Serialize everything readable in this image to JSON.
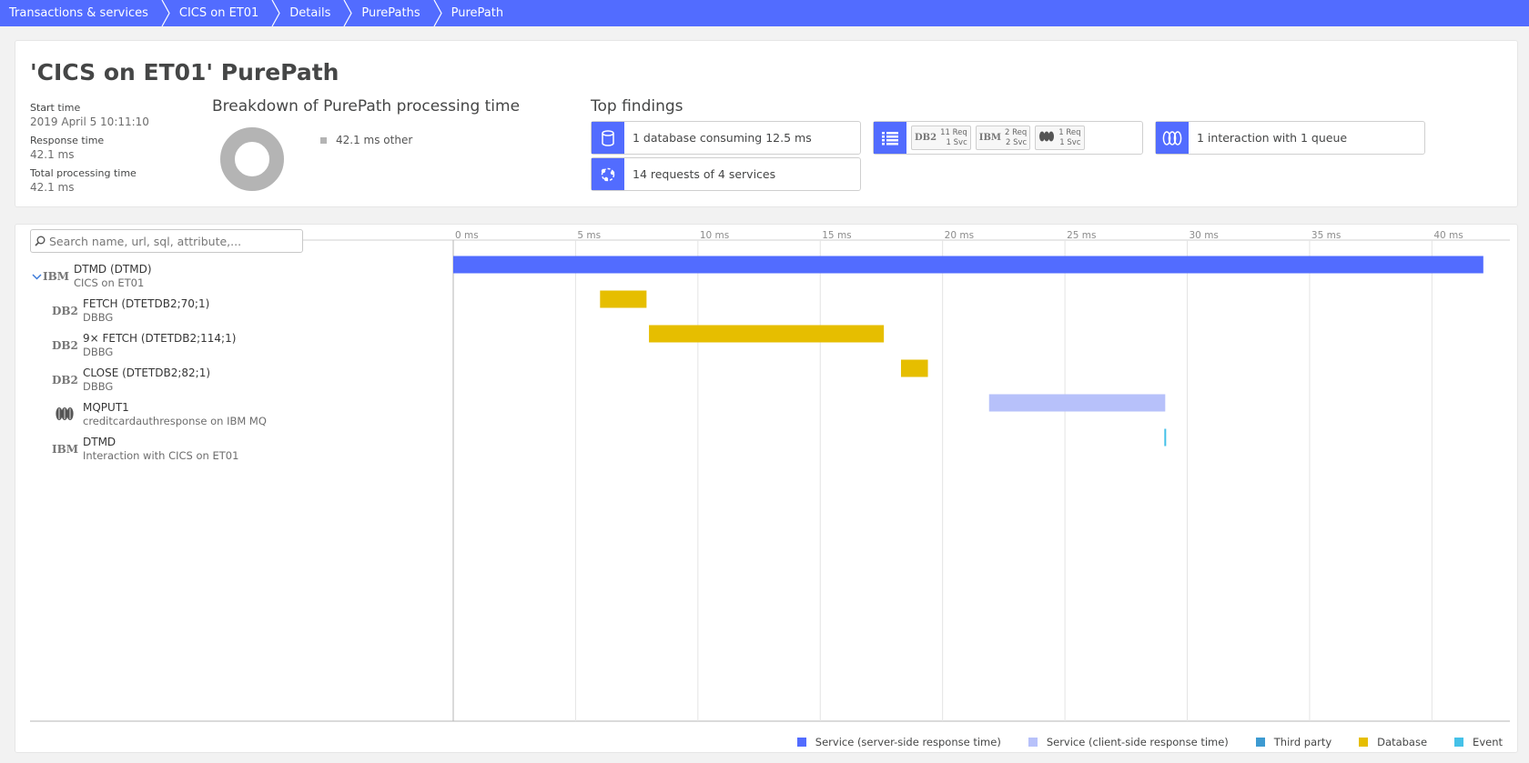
{
  "breadcrumb": [
    {
      "label": "Transactions & services"
    },
    {
      "label": "CICS on ET01"
    },
    {
      "label": "Details"
    },
    {
      "label": "PurePaths"
    },
    {
      "label": "PurePath"
    }
  ],
  "header": {
    "title": "'CICS on ET01' PurePath",
    "start_time_label": "Start time",
    "start_time_value": "2019 April 5 10:11:10",
    "response_time_label": "Response time",
    "response_time_value": "42.1 ms",
    "total_processing_label": "Total processing time",
    "total_processing_value": "42.1 ms"
  },
  "breakdown": {
    "title": "Breakdown of PurePath processing time",
    "legend_label": "42.1 ms other",
    "color": "#b4b4b4"
  },
  "findings": {
    "title": "Top findings",
    "database": "1 database consuming 12.5 ms",
    "requests": "14 requests of 4 services",
    "queue": "1 interaction with 1 queue",
    "chips": [
      {
        "logo": "DB2",
        "req": "11 Req",
        "svc": "1 Svc"
      },
      {
        "logo": "IBM",
        "req": "2 Req",
        "svc": "2 Svc"
      },
      {
        "logo": "MQ",
        "req": "1 Req",
        "svc": "1 Svc"
      }
    ]
  },
  "search": {
    "placeholder": "Search name, url, sql, attribute,..."
  },
  "tree": [
    {
      "logo": "IBM",
      "name": "DTMD (DTMD)",
      "sub": "CICS on ET01",
      "level": 0
    },
    {
      "logo": "DB2",
      "name": "FETCH (DTETDB2;70;1)",
      "sub": "DBBG",
      "level": 1
    },
    {
      "logo": "DB2",
      "name": "9× FETCH (DTETDB2;114;1)",
      "sub": "DBBG",
      "level": 1
    },
    {
      "logo": "DB2",
      "name": "CLOSE (DTETDB2;82;1)",
      "sub": "DBBG",
      "level": 1
    },
    {
      "logo": "MQ",
      "name": "MQPUT1",
      "sub": "creditcardauthresponse on IBM MQ",
      "level": 1
    },
    {
      "logo": "IBM",
      "name": "DTMD",
      "sub": "Interaction with CICS on ET01",
      "level": 1
    }
  ],
  "chart_data": {
    "type": "bar",
    "xlabel": "",
    "ylabel": "",
    "xlim": [
      0,
      43
    ],
    "x_ticks": [
      "0 ms",
      "5 ms",
      "10 ms",
      "15 ms",
      "20 ms",
      "25 ms",
      "30 ms",
      "35 ms",
      "40 ms"
    ],
    "x_tick_values": [
      0,
      5,
      10,
      15,
      20,
      25,
      30,
      35,
      40
    ],
    "bars": [
      {
        "row": 0,
        "start": 0,
        "end": 42.1,
        "kind": "server"
      },
      {
        "row": 1,
        "start": 6.0,
        "end": 7.9,
        "kind": "database"
      },
      {
        "row": 2,
        "start": 8.0,
        "end": 17.6,
        "kind": "database"
      },
      {
        "row": 3,
        "start": 18.3,
        "end": 19.4,
        "kind": "database"
      },
      {
        "row": 4,
        "start": 21.9,
        "end": 29.1,
        "kind": "client"
      },
      {
        "row": 5,
        "start": 29.1,
        "end": 29.2,
        "kind": "event"
      }
    ],
    "legend": [
      {
        "label": "Service (server-side response time)",
        "color": "#526cff",
        "kind": "server"
      },
      {
        "label": "Service (client-side response time)",
        "color": "#b7c1fa",
        "kind": "client"
      },
      {
        "label": "Third party",
        "color": "#3d9ad1",
        "kind": "third"
      },
      {
        "label": "Database",
        "color": "#e6be00",
        "kind": "database"
      },
      {
        "label": "Event",
        "color": "#45c1e8",
        "kind": "event"
      }
    ]
  }
}
